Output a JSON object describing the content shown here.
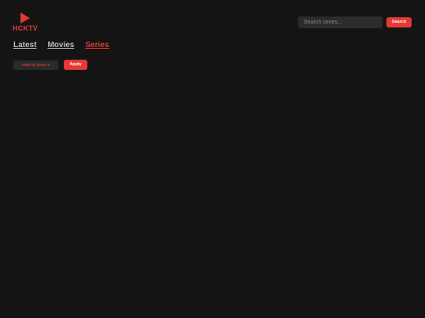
{
  "brand": {
    "name": "HCKTV",
    "accent_color": "#e53935",
    "icon": "play-triangle-icon"
  },
  "search": {
    "placeholder": "Search series...",
    "value": "",
    "button_label": "Search"
  },
  "nav": {
    "items": [
      {
        "label": "Latest",
        "active": false
      },
      {
        "label": "Movies",
        "active": false
      },
      {
        "label": "Series",
        "active": true
      }
    ]
  },
  "filter": {
    "genre_label": "Filter by Genre",
    "dropdown_icon": "caret-down-icon",
    "apply_label": "Apply"
  },
  "colors": {
    "background": "#141414",
    "accent": "#e53935",
    "inactive_link": "#bdbdbd"
  }
}
